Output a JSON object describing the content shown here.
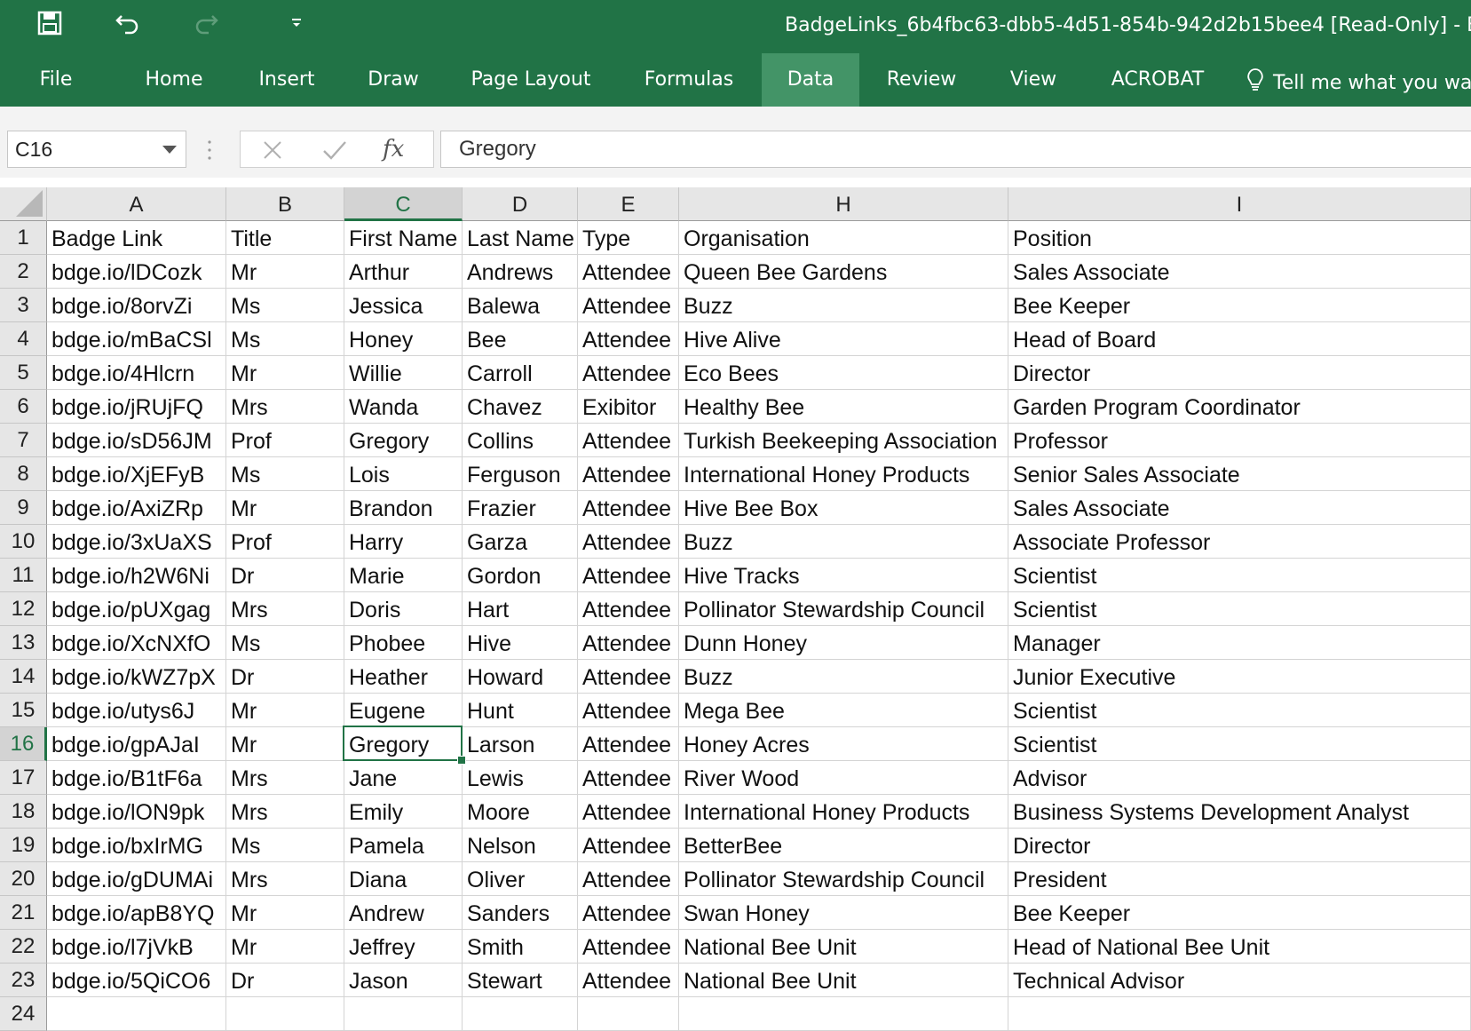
{
  "window": {
    "title": "BadgeLinks_6b4fbc63-dbb5-4d51-854b-942d2b15bee4  [Read-Only]  -  E"
  },
  "quick_access": [
    {
      "name": "save-icon"
    },
    {
      "name": "undo-icon"
    },
    {
      "name": "redo-icon"
    },
    {
      "name": "customize-qat-icon"
    }
  ],
  "ribbon": {
    "tabs": [
      "File",
      "Home",
      "Insert",
      "Draw",
      "Page Layout",
      "Formulas",
      "Data",
      "Review",
      "View",
      "ACROBAT"
    ],
    "active_tab": "Data",
    "tell_me": "Tell me what you wa"
  },
  "colors": {
    "brand": "#217346",
    "active_tab": "#439467",
    "header_bg": "#e6e6e6"
  },
  "formula_bar": {
    "name_box": "C16",
    "formula": "Gregory",
    "fx_label": "fx"
  },
  "sheet": {
    "columns": [
      "A",
      "B",
      "C",
      "D",
      "E",
      "H",
      "I"
    ],
    "selected_column": "C",
    "selected_row": "16",
    "rows": [
      {
        "num": "1",
        "cells": [
          "Badge Link",
          "Title",
          "First Name",
          "Last Name",
          "Type",
          "Organisation",
          "Position"
        ]
      },
      {
        "num": "2",
        "cells": [
          "bdge.io/lDCozk",
          "Mr",
          "Arthur",
          "Andrews",
          "Attendee",
          "Queen Bee Gardens",
          "Sales Associate"
        ]
      },
      {
        "num": "3",
        "cells": [
          "bdge.io/8orvZi",
          "Ms",
          "Jessica",
          "Balewa",
          "Attendee",
          "Buzz",
          "Bee Keeper"
        ]
      },
      {
        "num": "4",
        "cells": [
          "bdge.io/mBaCSl",
          "Ms",
          "Honey",
          "Bee",
          "Attendee",
          "Hive Alive",
          "Head of Board"
        ]
      },
      {
        "num": "5",
        "cells": [
          "bdge.io/4Hlcrn",
          "Mr",
          "Willie",
          "Carroll",
          "Attendee",
          "Eco Bees",
          "Director"
        ]
      },
      {
        "num": "6",
        "cells": [
          "bdge.io/jRUjFQ",
          "Mrs",
          "Wanda",
          "Chavez",
          "Exibitor",
          "Healthy Bee",
          "Garden Program Coordinator"
        ]
      },
      {
        "num": "7",
        "cells": [
          "bdge.io/sD56JM",
          "Prof",
          "Gregory",
          "Collins",
          "Attendee",
          "Turkish Beekeeping Association",
          "Professor"
        ]
      },
      {
        "num": "8",
        "cells": [
          "bdge.io/XjEFyB",
          "Ms",
          "Lois",
          "Ferguson",
          "Attendee",
          "International Honey Products",
          "Senior Sales Associate"
        ]
      },
      {
        "num": "9",
        "cells": [
          "bdge.io/AxiZRp",
          "Mr",
          "Brandon",
          "Frazier",
          "Attendee",
          "Hive Bee Box",
          "Sales Associate"
        ]
      },
      {
        "num": "10",
        "cells": [
          "bdge.io/3xUaXS",
          "Prof",
          "Harry",
          "Garza",
          "Attendee",
          "Buzz",
          "Associate Professor"
        ]
      },
      {
        "num": "11",
        "cells": [
          "bdge.io/h2W6Ni",
          "Dr",
          "Marie",
          "Gordon",
          "Attendee",
          "Hive Tracks",
          "Scientist"
        ]
      },
      {
        "num": "12",
        "cells": [
          "bdge.io/pUXgag",
          "Mrs",
          "Doris",
          "Hart",
          "Attendee",
          "Pollinator Stewardship Council",
          "Scientist"
        ]
      },
      {
        "num": "13",
        "cells": [
          "bdge.io/XcNXfO",
          "Ms",
          "Phobee",
          "Hive",
          "Attendee",
          "Dunn Honey",
          "Manager"
        ]
      },
      {
        "num": "14",
        "cells": [
          "bdge.io/kWZ7pX",
          "Dr",
          "Heather",
          "Howard",
          "Attendee",
          "Buzz",
          "Junior Executive"
        ]
      },
      {
        "num": "15",
        "cells": [
          "bdge.io/utys6J",
          "Mr",
          "Eugene",
          "Hunt",
          "Attendee",
          "Mega Bee",
          "Scientist"
        ]
      },
      {
        "num": "16",
        "cells": [
          "bdge.io/gpAJaI",
          "Mr",
          "Gregory",
          "Larson",
          "Attendee",
          "Honey Acres",
          "Scientist"
        ]
      },
      {
        "num": "17",
        "cells": [
          "bdge.io/B1tF6a",
          "Mrs",
          "Jane",
          "Lewis",
          "Attendee",
          "River Wood",
          "Advisor"
        ]
      },
      {
        "num": "18",
        "cells": [
          "bdge.io/lON9pk",
          "Mrs",
          "Emily",
          "Moore",
          "Attendee",
          "International Honey Products",
          "Business Systems Development Analyst"
        ]
      },
      {
        "num": "19",
        "cells": [
          "bdge.io/bxIrMG",
          "Ms",
          "Pamela",
          "Nelson",
          "Attendee",
          "BetterBee",
          "Director"
        ]
      },
      {
        "num": "20",
        "cells": [
          "bdge.io/gDUMAi",
          "Mrs",
          "Diana",
          "Oliver",
          "Attendee",
          "Pollinator Stewardship Council",
          "President"
        ]
      },
      {
        "num": "21",
        "cells": [
          "bdge.io/apB8YQ",
          "Mr",
          "Andrew",
          "Sanders",
          "Attendee",
          "Swan Honey",
          "Bee Keeper"
        ]
      },
      {
        "num": "22",
        "cells": [
          "bdge.io/l7jVkB",
          "Mr",
          "Jeffrey",
          "Smith",
          "Attendee",
          "National Bee Unit",
          "Head of National Bee Unit"
        ]
      },
      {
        "num": "23",
        "cells": [
          "bdge.io/5QiCO6",
          "Dr",
          "Jason",
          "Stewart",
          "Attendee",
          "National Bee Unit",
          "Technical Advisor"
        ]
      },
      {
        "num": "24",
        "cells": [
          "",
          "",
          "",
          "",
          "",
          "",
          ""
        ]
      }
    ]
  }
}
